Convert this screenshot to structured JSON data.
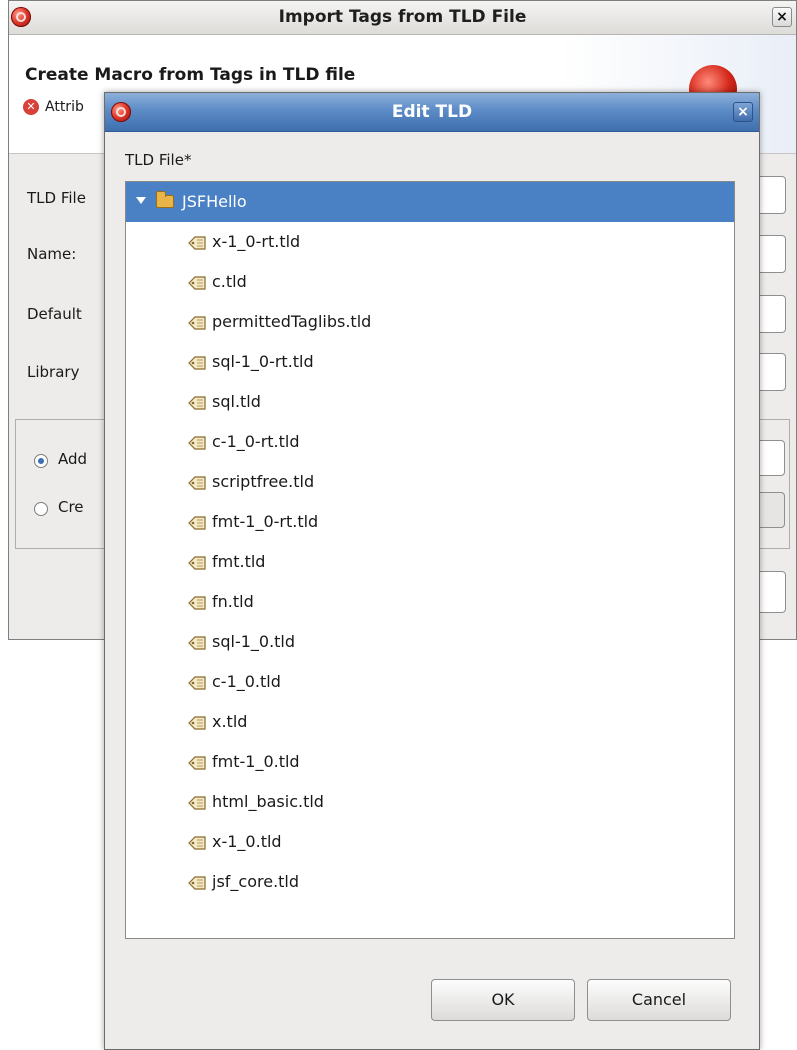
{
  "background_dialog": {
    "title": "Import Tags from TLD File",
    "close_glyph": "×",
    "heading": "Create Macro from Tags in TLD file",
    "error_text": "Attrib",
    "labels": [
      "TLD File",
      "Name:",
      "Default",
      "Library"
    ],
    "radios": [
      {
        "label": "Add",
        "checked": true
      },
      {
        "label": "Cre",
        "checked": false
      }
    ]
  },
  "edit_tld": {
    "title": "Edit TLD",
    "close_glyph": "×",
    "field_label": "TLD File*",
    "tree": {
      "root": "JSFHello",
      "items": [
        "x-1_0-rt.tld",
        "c.tld",
        "permittedTaglibs.tld",
        "sql-1_0-rt.tld",
        "sql.tld",
        "c-1_0-rt.tld",
        "scriptfree.tld",
        "fmt-1_0-rt.tld",
        "fmt.tld",
        "fn.tld",
        "sql-1_0.tld",
        "c-1_0.tld",
        "x.tld",
        "fmt-1_0.tld",
        "html_basic.tld",
        "x-1_0.tld",
        "jsf_core.tld"
      ]
    },
    "ok_label": "OK",
    "cancel_label": "Cancel"
  },
  "colors": {
    "selection": "#4a81c4",
    "titlebar_active": "#5c8bc6"
  }
}
